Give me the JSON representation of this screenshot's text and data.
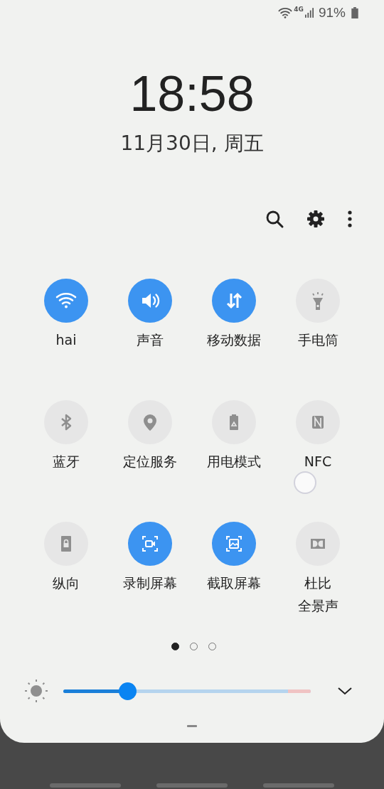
{
  "status_bar": {
    "network": "4G",
    "battery": "91%"
  },
  "clock": {
    "time": "18:58",
    "date": "11月30日, 周五"
  },
  "tiles": [
    {
      "label": "hai",
      "on": true
    },
    {
      "label": "声音",
      "on": true
    },
    {
      "label": "移动数据",
      "on": true
    },
    {
      "label": "手电筒",
      "on": false
    },
    {
      "label": "蓝牙",
      "on": false
    },
    {
      "label": "定位服务",
      "on": false
    },
    {
      "label": "用电模式",
      "on": false
    },
    {
      "label": "NFC",
      "on": false
    },
    {
      "label": "纵向",
      "on": false
    },
    {
      "label": "录制屏幕",
      "on": true
    },
    {
      "label": "截取屏幕",
      "on": true
    },
    {
      "label": "杜比",
      "label_2": "全景声",
      "on": false
    }
  ],
  "pages": [
    {
      "selected": true
    },
    {
      "selected": false
    },
    {
      "selected": false
    }
  ],
  "brightness": {
    "level": 0.26
  }
}
